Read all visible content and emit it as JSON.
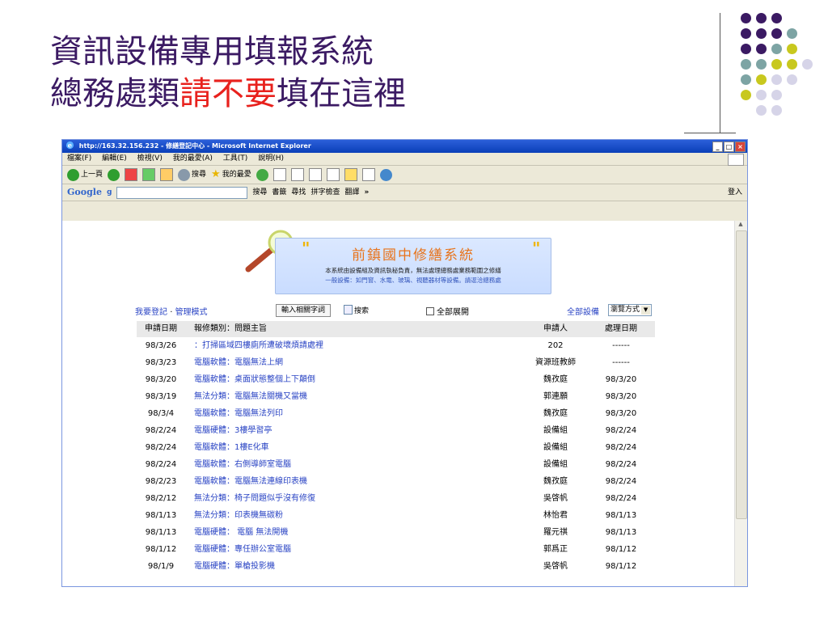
{
  "slide": {
    "title_line1": "資訊設備專用填報系統",
    "title_line2_prefix": "總務處類",
    "title_line2_red": "請不要",
    "title_line2_suffix": "填在這裡",
    "dot_colors": [
      "#3b1a63",
      "#7da4a4",
      "#c8c81e",
      "#d6d4e8"
    ]
  },
  "browser": {
    "window_title": "http://163.32.156.232 - 修繕登記中心 - Microsoft Internet Explorer",
    "window_buttons": [
      "_",
      "□",
      "×"
    ],
    "menu": [
      "檔案(F)",
      "編輯(E)",
      "檢視(V)",
      "我的最愛(A)",
      "工具(T)",
      "說明(H)"
    ],
    "toolbar": {
      "back": "上一頁",
      "search": "搜尋",
      "favorites": "我的最愛"
    },
    "google": {
      "logo": "Google",
      "g_icon": "g",
      "search_btn": "搜尋",
      "bookmarks": "書籤",
      "find": "尋找",
      "spellcheck": "拼字檢查",
      "translate": "翻譯",
      "more": "»",
      "signin": "登入"
    }
  },
  "page": {
    "banner": {
      "title": "前鎮國中修繕系統",
      "line1": "本系統由設備組及資訊執秘負責，無法處理總務處業務範圍之修繕",
      "line2": "一般設備：如門窗、水電、玻璃、視聽器材等設備。請逕洽總務處"
    },
    "links": {
      "register": "我要登記",
      "separator": "·",
      "admin": "管理模式",
      "keyword_btn": "輸入相關字詞",
      "search": "搜索",
      "expand_all": "全部展開",
      "all_equipment": "全部設備",
      "view_mode": "瀏覽方式"
    },
    "table": {
      "headers": {
        "date": "申請日期",
        "category_subject": "報修類別：問題主旨",
        "applicant": "申請人",
        "done_date": "處理日期"
      },
      "rows": [
        {
          "date": "98/3/26",
          "category": "",
          "subject": "打掃區域四樓廁所遭破壞煩請處裡",
          "applicant": "202",
          "done": "------"
        },
        {
          "date": "98/3/23",
          "category": "電腦軟體",
          "subject": "電腦無法上網",
          "applicant": "資源班教師",
          "done": "------"
        },
        {
          "date": "98/3/20",
          "category": "電腦軟體",
          "subject": "桌面狀態整個上下顛倒",
          "applicant": "魏孜庭",
          "done": "98/3/20"
        },
        {
          "date": "98/3/19",
          "category": "無法分類",
          "subject": "電腦無法關機又當機",
          "applicant": "郭連願",
          "done": "98/3/20"
        },
        {
          "date": "98/3/4",
          "category": "電腦軟體",
          "subject": "電腦無法列印",
          "applicant": "魏孜庭",
          "done": "98/3/20"
        },
        {
          "date": "98/2/24",
          "category": "電腦硬體",
          "subject": "3樓學習亭",
          "applicant": "設備組",
          "done": "98/2/24"
        },
        {
          "date": "98/2/24",
          "category": "電腦軟體",
          "subject": "1樓E化車",
          "applicant": "設備組",
          "done": "98/2/24"
        },
        {
          "date": "98/2/24",
          "category": "電腦軟體",
          "subject": "右側導師室電腦",
          "applicant": "設備組",
          "done": "98/2/24"
        },
        {
          "date": "98/2/23",
          "category": "電腦軟體",
          "subject": "電腦無法連線印表機",
          "applicant": "魏孜庭",
          "done": "98/2/24"
        },
        {
          "date": "98/2/12",
          "category": "無法分類",
          "subject": "椅子問題似乎沒有修復",
          "applicant": "吳啓帆",
          "done": "98/2/24"
        },
        {
          "date": "98/1/13",
          "category": "無法分類",
          "subject": "印表機無碳粉",
          "applicant": "林怡君",
          "done": "98/1/13"
        },
        {
          "date": "98/1/13",
          "category": "電腦硬體",
          "subject": " 電腦 無法開機",
          "applicant": "羅元祺",
          "done": "98/1/13"
        },
        {
          "date": "98/1/12",
          "category": "電腦硬體",
          "subject": "專任辦公室電腦",
          "applicant": "郭爲正",
          "done": "98/1/12"
        },
        {
          "date": "98/1/9",
          "category": "電腦硬體",
          "subject": "單槍投影機",
          "applicant": "吳啓帆",
          "done": "98/1/12"
        }
      ]
    }
  }
}
